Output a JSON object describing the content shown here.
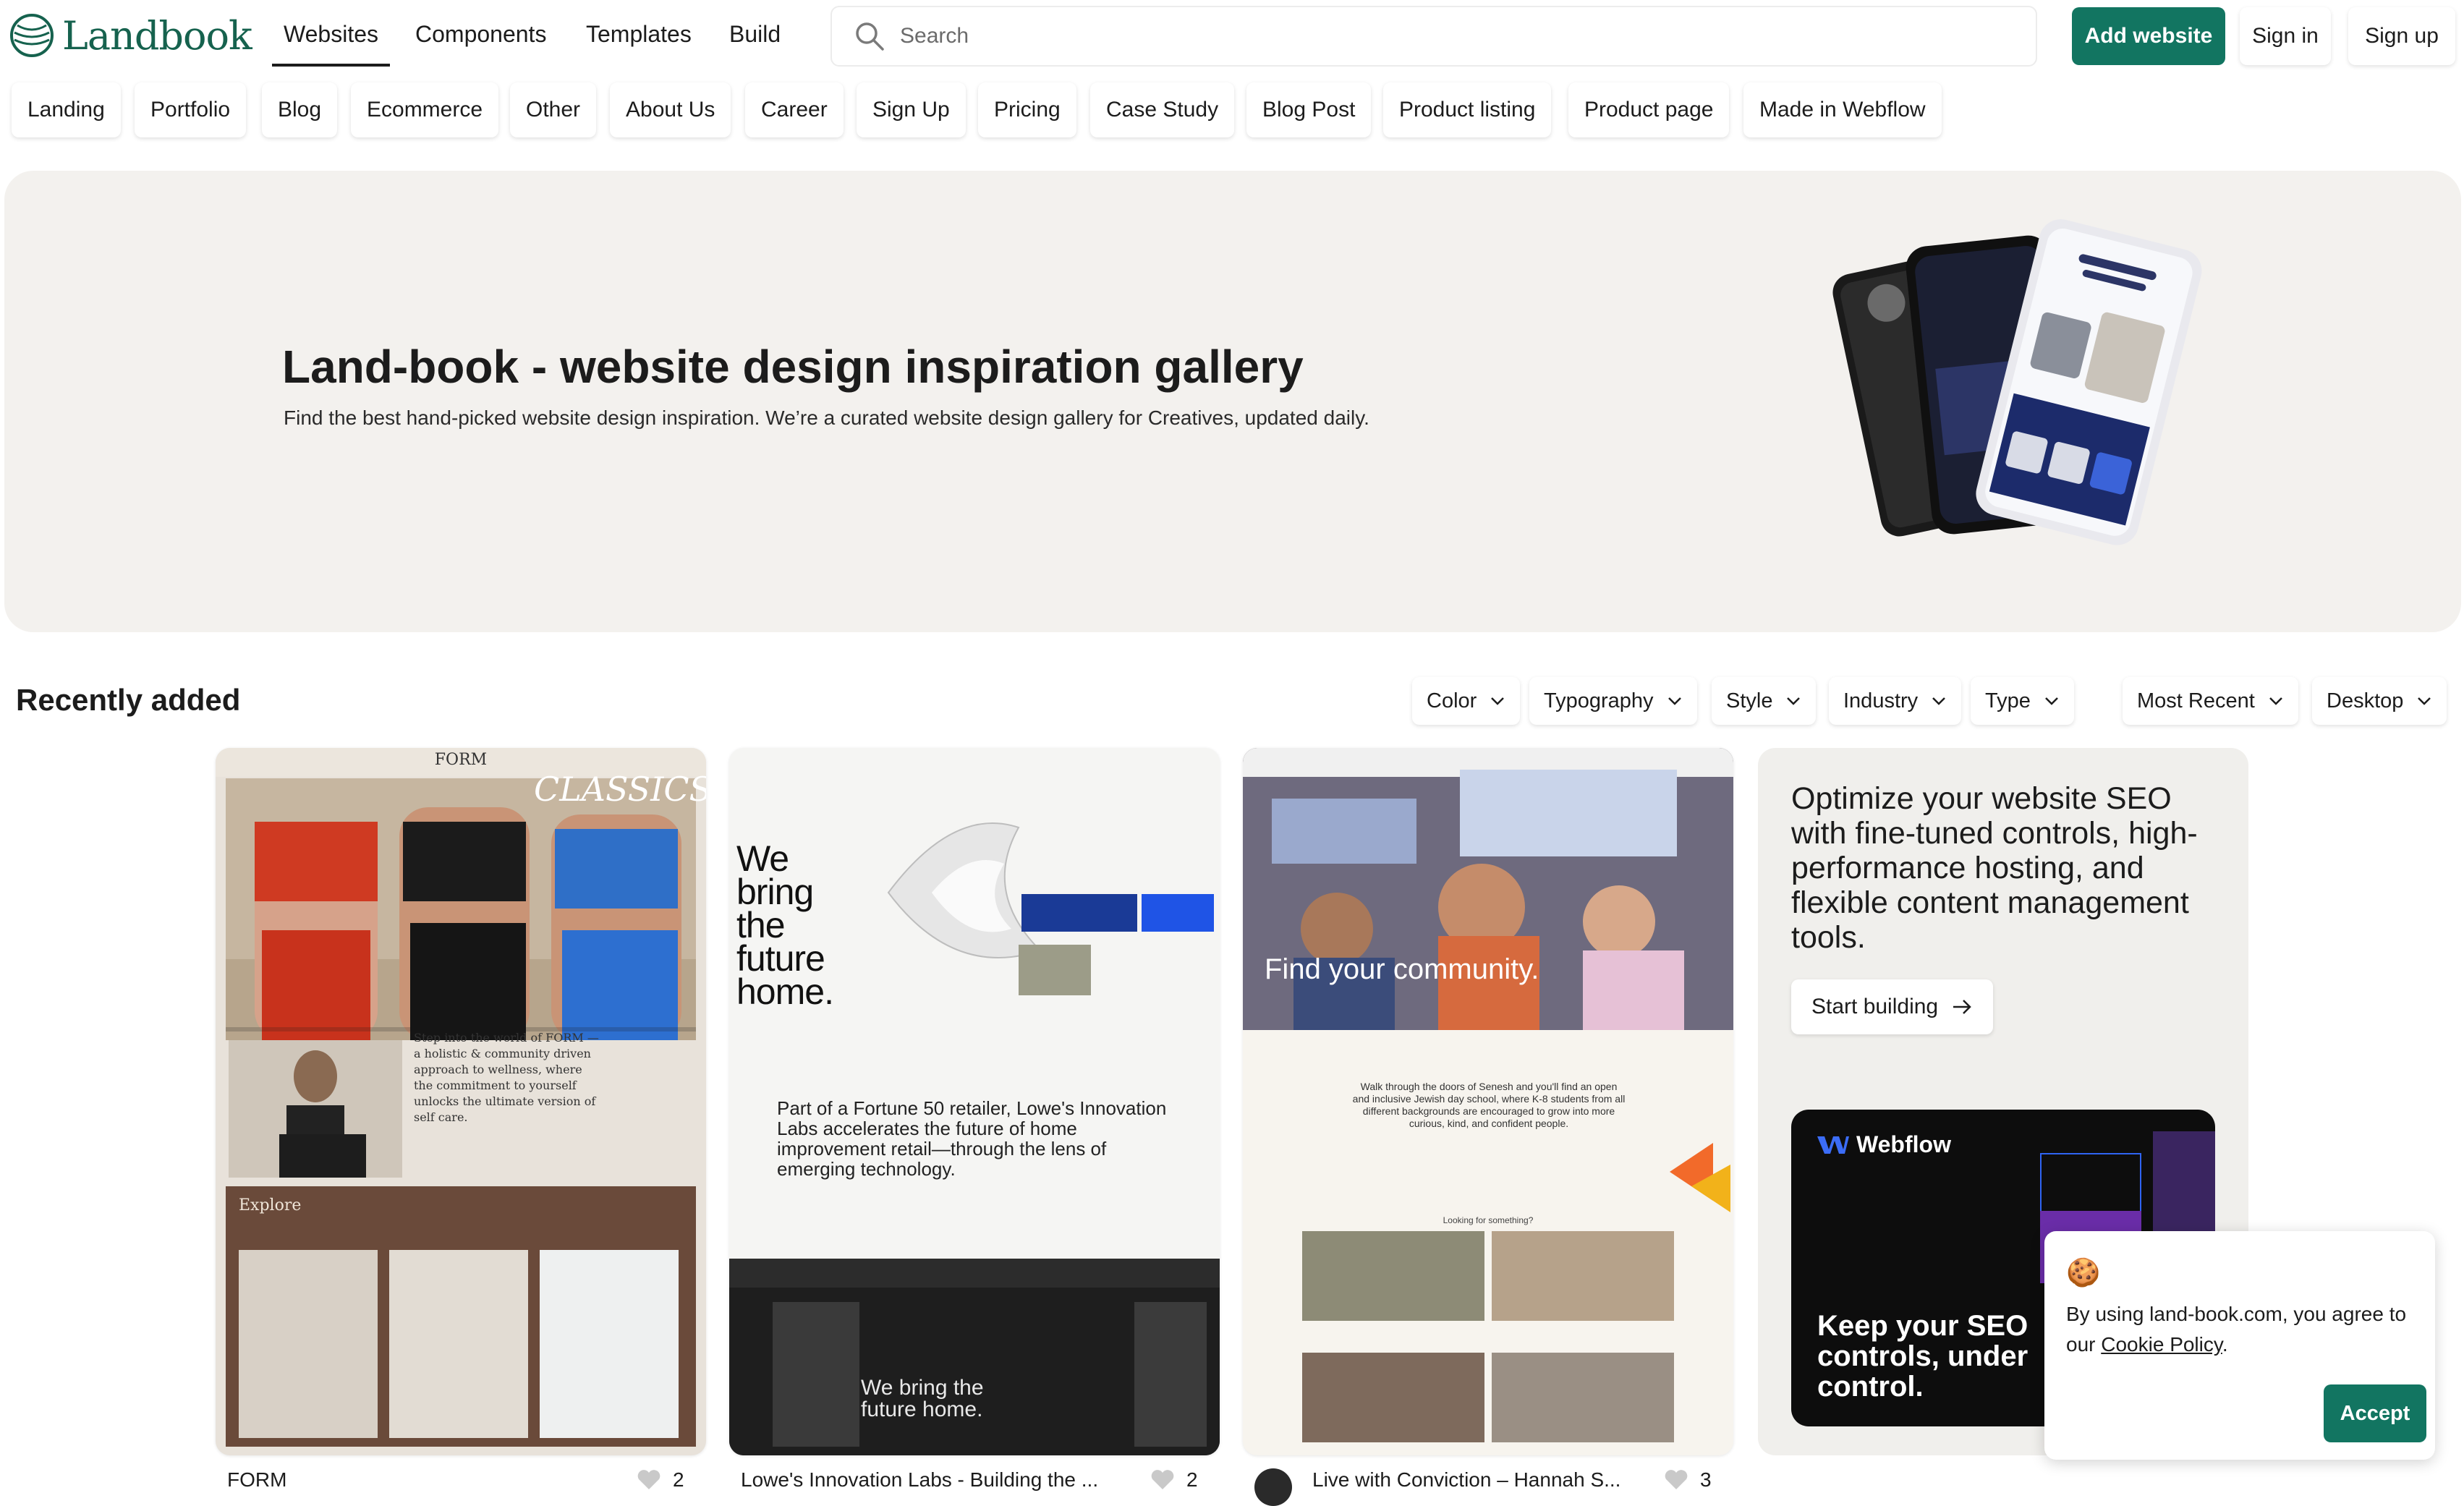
{
  "logo": {
    "text": "Landbook"
  },
  "nav": {
    "items": [
      "Websites",
      "Components",
      "Templates",
      "Build"
    ],
    "active": "Websites"
  },
  "search": {
    "placeholder": "Search"
  },
  "header_buttons": {
    "add_website": "Add website",
    "sign_in": "Sign in",
    "sign_up": "Sign up"
  },
  "categories": [
    "Landing",
    "Portfolio",
    "Blog",
    "Ecommerce",
    "Other",
    "About Us",
    "Career",
    "Sign Up",
    "Pricing",
    "Case Study",
    "Blog Post",
    "Product listing",
    "Product page",
    "Made in Webflow"
  ],
  "hero": {
    "title": "Land-book - website design inspiration gallery",
    "subtitle": "Find the best hand-picked website design inspiration. We’re a curated website design gallery for Creatives, updated daily."
  },
  "recent": {
    "title": "Recently added",
    "filters": [
      "Color",
      "Typography",
      "Style",
      "Industry",
      "Type"
    ],
    "sort": "Most Recent",
    "device": "Desktop"
  },
  "cards": [
    {
      "caption": "FORM",
      "likes": "2",
      "brand": "FORM",
      "overlay": "CLASSICS",
      "body": "Step into the world of FORM — a holistic & community driven approach to wellness, where the commitment to yourself unlocks the ultimate version of self care.",
      "section": "Explore"
    },
    {
      "caption": "Lowe's Innovation Labs - Building the ...",
      "likes": "2",
      "headline": "We bring the future home.",
      "body": "Part of a Fortune 50 retailer, Lowe's Innovation Labs accelerates the future of home improvement retail—through the lens of emerging technology.",
      "footer": "We bring the future home."
    },
    {
      "caption": "Live with Conviction – Hannah S...",
      "likes": "3",
      "headline": "Find your community.",
      "body": "Walk through the doors of Senesh and you'll find an open and inclusive Jewish day school, where K-8 students from all different backgrounds are encouraged to grow into more curious, kind, and confident people.",
      "looking": "Looking for something?"
    }
  ],
  "seo_card": {
    "text": "Optimize your website SEO with fine-tuned controls, high-performance hosting, and flexible content management tools.",
    "button": "Start building",
    "promo_brand": "Webflow",
    "promo_text": "Keep your SEO controls, under control."
  },
  "cookie": {
    "text": "By using land-book.com, you agree to our",
    "link": "Cookie Policy",
    "period": ".",
    "button": "Accept"
  },
  "colors": {
    "brand_green": "#127561",
    "hero_bg": "#f3f1ee",
    "logo_green": "#16624e"
  }
}
